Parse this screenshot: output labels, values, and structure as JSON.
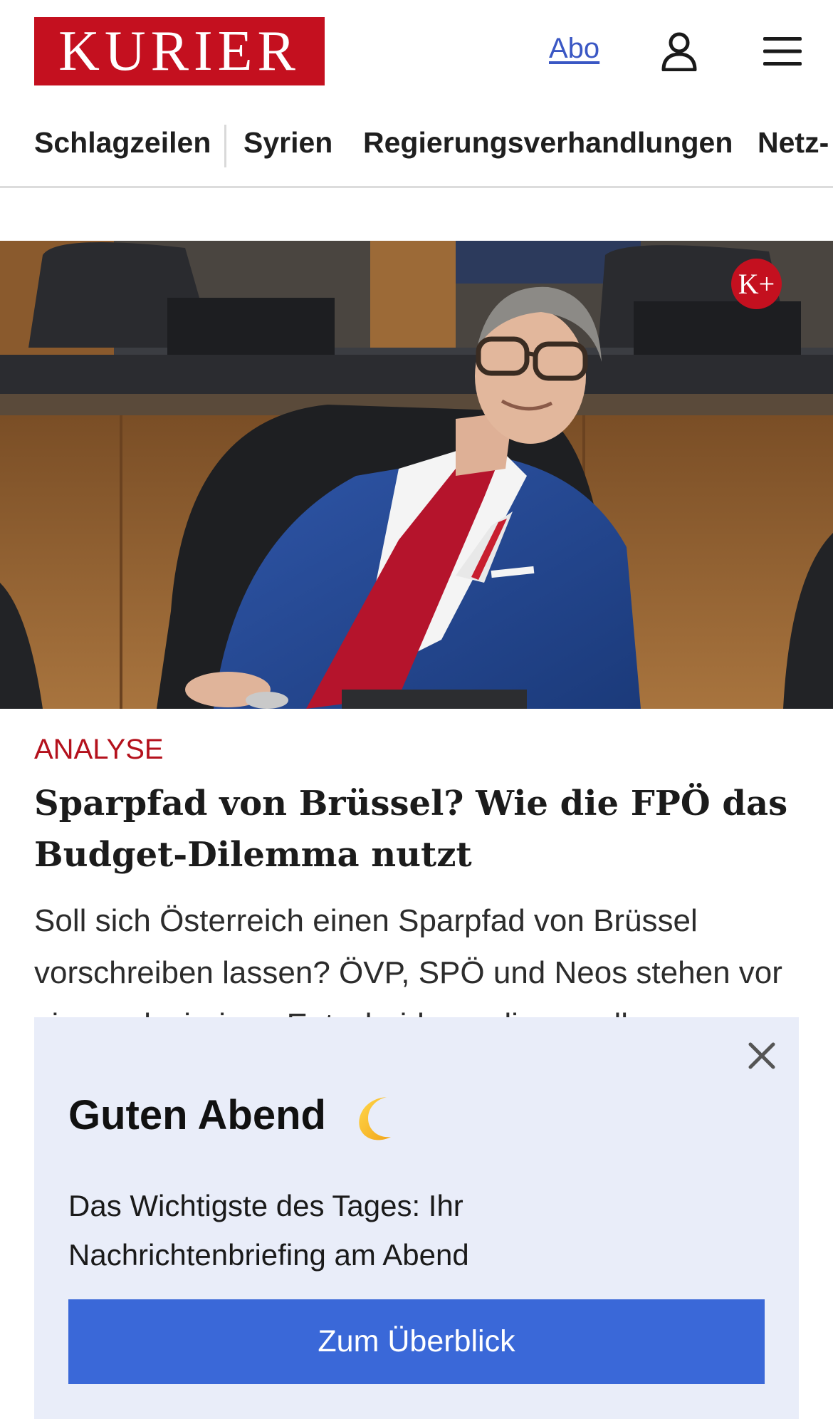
{
  "header": {
    "logo_text": "KURIER",
    "abo_label": "Abo",
    "user_icon": "user-icon",
    "menu_icon": "hamburger-menu-icon"
  },
  "nav": {
    "items": [
      {
        "label": "Schlagzeilen"
      },
      {
        "label": "Syrien"
      },
      {
        "label": "Regierungsverhandlungen"
      },
      {
        "label": "Netz-"
      }
    ]
  },
  "hero": {
    "badge_text": "K+",
    "image_alt": "Politician in blue suit and red tie seated in parliament"
  },
  "article": {
    "kicker": "ANALYSE",
    "headline": "Sparpfad von Brüssel? Wie die FPÖ das Budget-Dilemma nutzt",
    "teaser": "Soll sich Österreich einen Sparpfad von Brüssel vorschreiben lassen? ÖVP, SPÖ und Neos stehen vor einer schwierigen Entscheidung, die vor allem"
  },
  "popup": {
    "title": "Guten Abend",
    "title_icon": "moon-icon",
    "text": "Das Wichtigste des Tages: Ihr Nachrichtenbriefing am Abend",
    "button_label": "Zum Überblick",
    "close_icon": "close-icon"
  },
  "colors": {
    "brand_red": "#c4101f",
    "link_blue": "#3a57c4",
    "button_blue": "#3a68d8",
    "popup_bg": "#e9edf9"
  }
}
